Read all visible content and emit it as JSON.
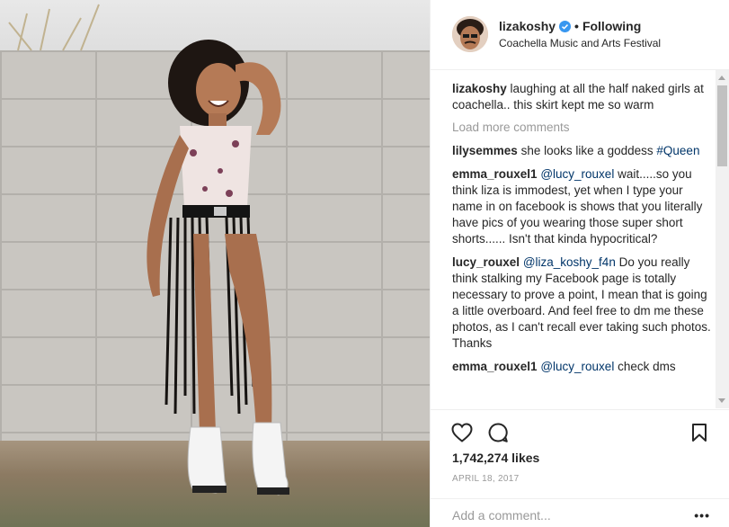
{
  "post": {
    "username": "lizakoshy",
    "follow_separator": "•",
    "follow_status": "Following",
    "location": "Coachella Music and Arts Festival",
    "caption_user": "lizakoshy",
    "caption_text": " laughing at all the half naked girls at coachella.. this skirt kept me so warm",
    "load_more": "Load more comments",
    "comments": [
      {
        "user": "lilysemmes",
        "mention": "",
        "text": " she looks like a goddess ",
        "tag": "#Queen"
      },
      {
        "user": "emma_rouxel1",
        "mention": "@lucy_rouxel",
        "text": " wait.....so you think liza is immodest, yet when I type your name in on facebook is shows that you literally have pics of you wearing those super short shorts...... Isn't that kinda hypocritical?",
        "tag": ""
      },
      {
        "user": "lucy_rouxel",
        "mention": "@liza_koshy_f4n",
        "text": " Do you really think stalking my Facebook page is totally necessary to prove a point, I mean that is going a little overboard. And feel free to dm me these photos, as I can't recall ever taking such photos. Thanks",
        "tag": ""
      },
      {
        "user": "emma_rouxel1",
        "mention": "@lucy_rouxel",
        "text": " check dms",
        "tag": ""
      }
    ],
    "likes": "1,742,274 likes",
    "date": "APRIL 18, 2017",
    "comment_placeholder": "Add a comment...",
    "more_label": "•••"
  },
  "icons": {
    "like": "heart-icon",
    "comment": "speech-bubble-icon",
    "save": "bookmark-icon",
    "verified": "verified-badge-icon"
  },
  "colors": {
    "mention": "#003569",
    "verified": "#3897f0",
    "muted": "#999999"
  }
}
